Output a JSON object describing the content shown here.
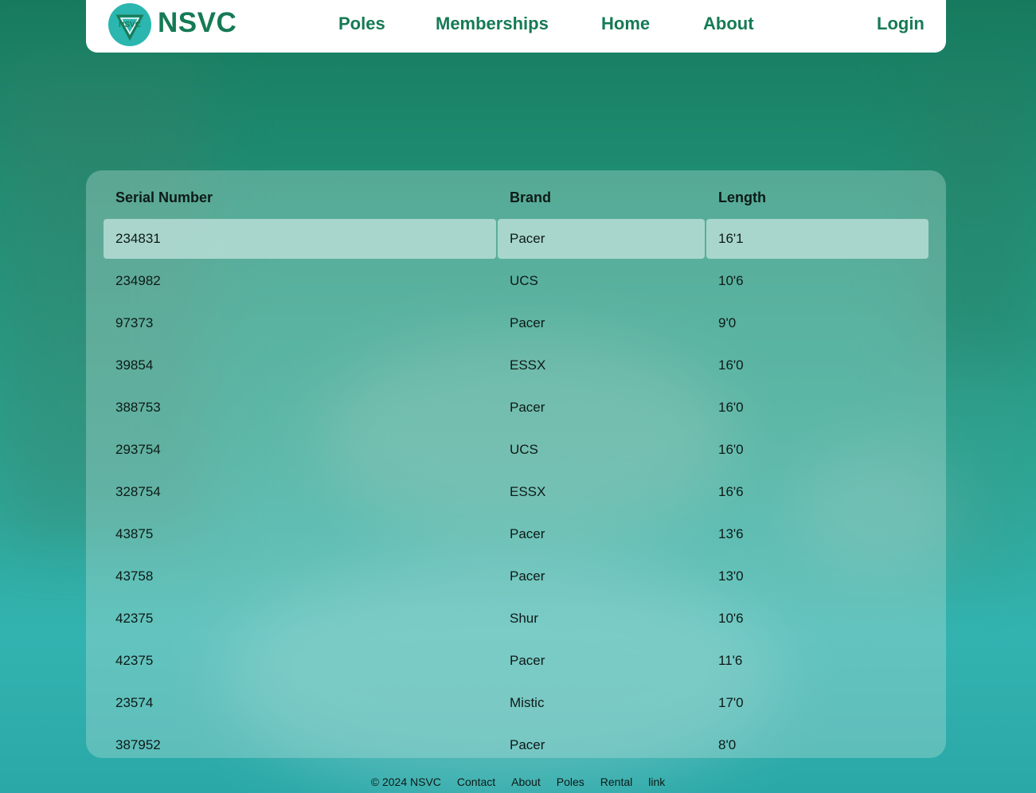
{
  "brand": {
    "name": "NSVC",
    "logo_label": "NSVC"
  },
  "nav": {
    "links": [
      "Poles",
      "Memberships",
      "Home",
      "About"
    ],
    "login": "Login"
  },
  "table": {
    "headers": [
      "Serial Number",
      "Brand",
      "Length"
    ],
    "rows": [
      [
        "234831",
        "Pacer",
        "16'1"
      ],
      [
        "234982",
        "UCS",
        "10'6"
      ],
      [
        "97373",
        "Pacer",
        "9'0"
      ],
      [
        "39854",
        "ESSX",
        "16'0"
      ],
      [
        "388753",
        "Pacer",
        "16'0"
      ],
      [
        "293754",
        "UCS",
        "16'0"
      ],
      [
        "328754",
        "ESSX",
        "16'6"
      ],
      [
        "43875",
        "Pacer",
        "13'6"
      ],
      [
        "43758",
        "Pacer",
        "13'0"
      ],
      [
        "42375",
        "Shur",
        "10'6"
      ],
      [
        "42375",
        "Pacer",
        "11'6"
      ],
      [
        "23574",
        "Mistic",
        "17'0"
      ],
      [
        "387952",
        "Pacer",
        "8'0"
      ]
    ],
    "selected_row": 0
  },
  "footer": {
    "copyright": "© 2024 NSVC",
    "links": [
      "Contact",
      "About",
      "Poles",
      "Rental",
      "link"
    ]
  },
  "colors": {
    "brand_green": "#157a55",
    "logo_teal": "#2bb6b0"
  }
}
